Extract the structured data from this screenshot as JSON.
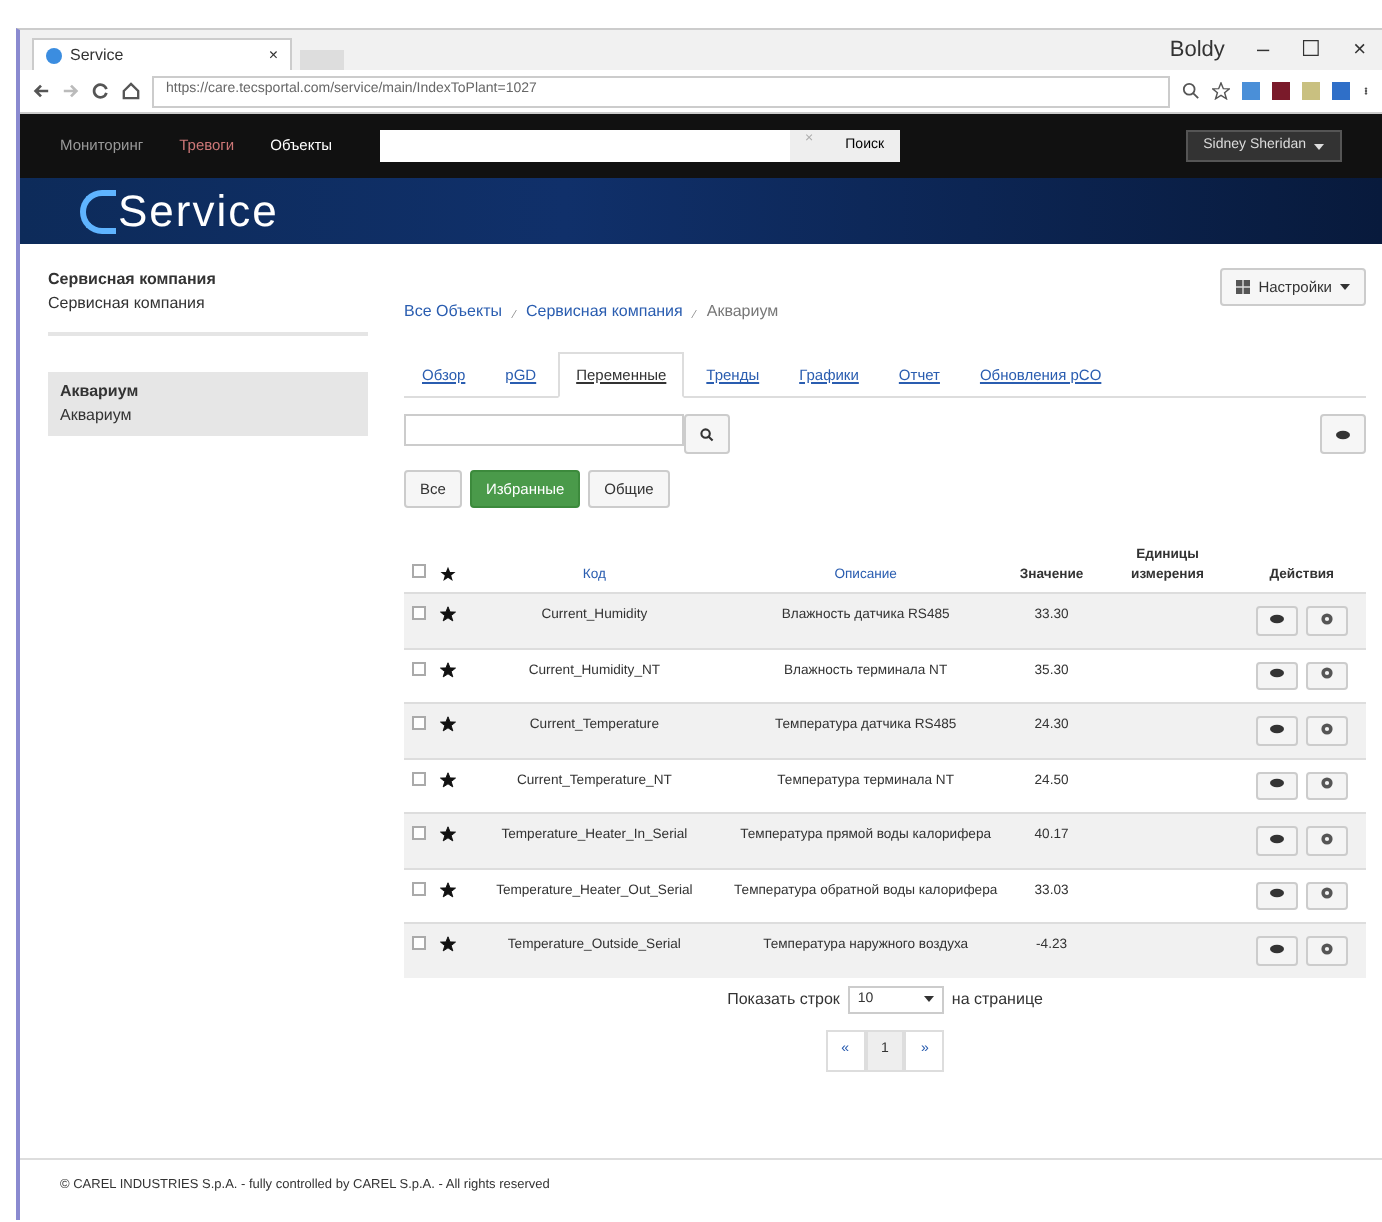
{
  "browser": {
    "tab_title": "Service",
    "tab_close": "×",
    "url": "https://care.tecsportal.com/service/main/IndexToPlant=1027",
    "profile": "Boldy",
    "window_buttons": [
      "–",
      "☐",
      "×"
    ]
  },
  "navbar": {
    "items": [
      "Мониторинг",
      "Тревоги",
      "Объекты"
    ],
    "search_clear": "×",
    "search_button": "Поиск",
    "user": "Sidney Sheridan"
  },
  "logo": "Service",
  "sidebar": {
    "company": "Сервисная компания",
    "company_sub": "Сервисная компания",
    "items": [
      {
        "title": "Аквариум",
        "subtitle": "Аквариум",
        "selected": true
      }
    ]
  },
  "settings_button": "Настройки",
  "breadcrumb": [
    "Все Объекты",
    "Сервисная компания",
    "Аквариум"
  ],
  "tabs": [
    {
      "label": "Обзор",
      "selected": false
    },
    {
      "label": "pGD",
      "selected": false
    },
    {
      "label": "Переменные",
      "selected": true
    },
    {
      "label": "Тренды",
      "selected": false
    },
    {
      "label": "Графики",
      "selected": false
    },
    {
      "label": "Отчет",
      "selected": false
    },
    {
      "label": "Обновления pCO",
      "selected": false
    }
  ],
  "filters": [
    {
      "label": "Все",
      "selected": false
    },
    {
      "label": "Избранные",
      "selected": true
    },
    {
      "label": "Общие",
      "selected": false
    }
  ],
  "table": {
    "select_all_checked": false,
    "columns": [
      "Код",
      "Описание",
      "Значение",
      "Единицы измерения",
      "Действия"
    ],
    "rows": [
      {
        "checked": false,
        "favorite": true,
        "code": "Current_Humidity",
        "description": "Влажность датчика RS485",
        "value": "33.30"
      },
      {
        "checked": false,
        "favorite": true,
        "code": "Current_Humidity_NT",
        "description": "Влажность терминала NT",
        "value": "35.30"
      },
      {
        "checked": false,
        "favorite": true,
        "code": "Current_Temperature",
        "description": "Температура датчика RS485",
        "value": "24.30"
      },
      {
        "checked": false,
        "favorite": true,
        "code": "Current_Temperature_NT",
        "description": "Температура терминала NT",
        "value": "24.50"
      },
      {
        "checked": false,
        "favorite": true,
        "code": "Temperature_Heater_In_Serial",
        "description": "Температура прямой воды калорифера",
        "value": "40.17"
      },
      {
        "checked": false,
        "favorite": true,
        "code": "Temperature_Heater_Out_Serial",
        "description": "Температура обратной воды калорифера",
        "value": "33.03"
      },
      {
        "checked": false,
        "favorite": true,
        "code": "Temperature_Outside_Serial",
        "description": "Температура наружного воздуха",
        "value": "-4.23"
      }
    ]
  },
  "pagination": {
    "show_label": "Показать строк",
    "page_size": "10",
    "per_page_label": "на странице",
    "pages": [
      {
        "label": "«",
        "selected": false
      },
      {
        "label": "1",
        "selected": true
      },
      {
        "label": "»",
        "selected": false
      }
    ]
  },
  "footer": "© CAREL INDUSTRIES S.p.A. - fully controlled by CAREL S.p.A. - All rights reserved"
}
